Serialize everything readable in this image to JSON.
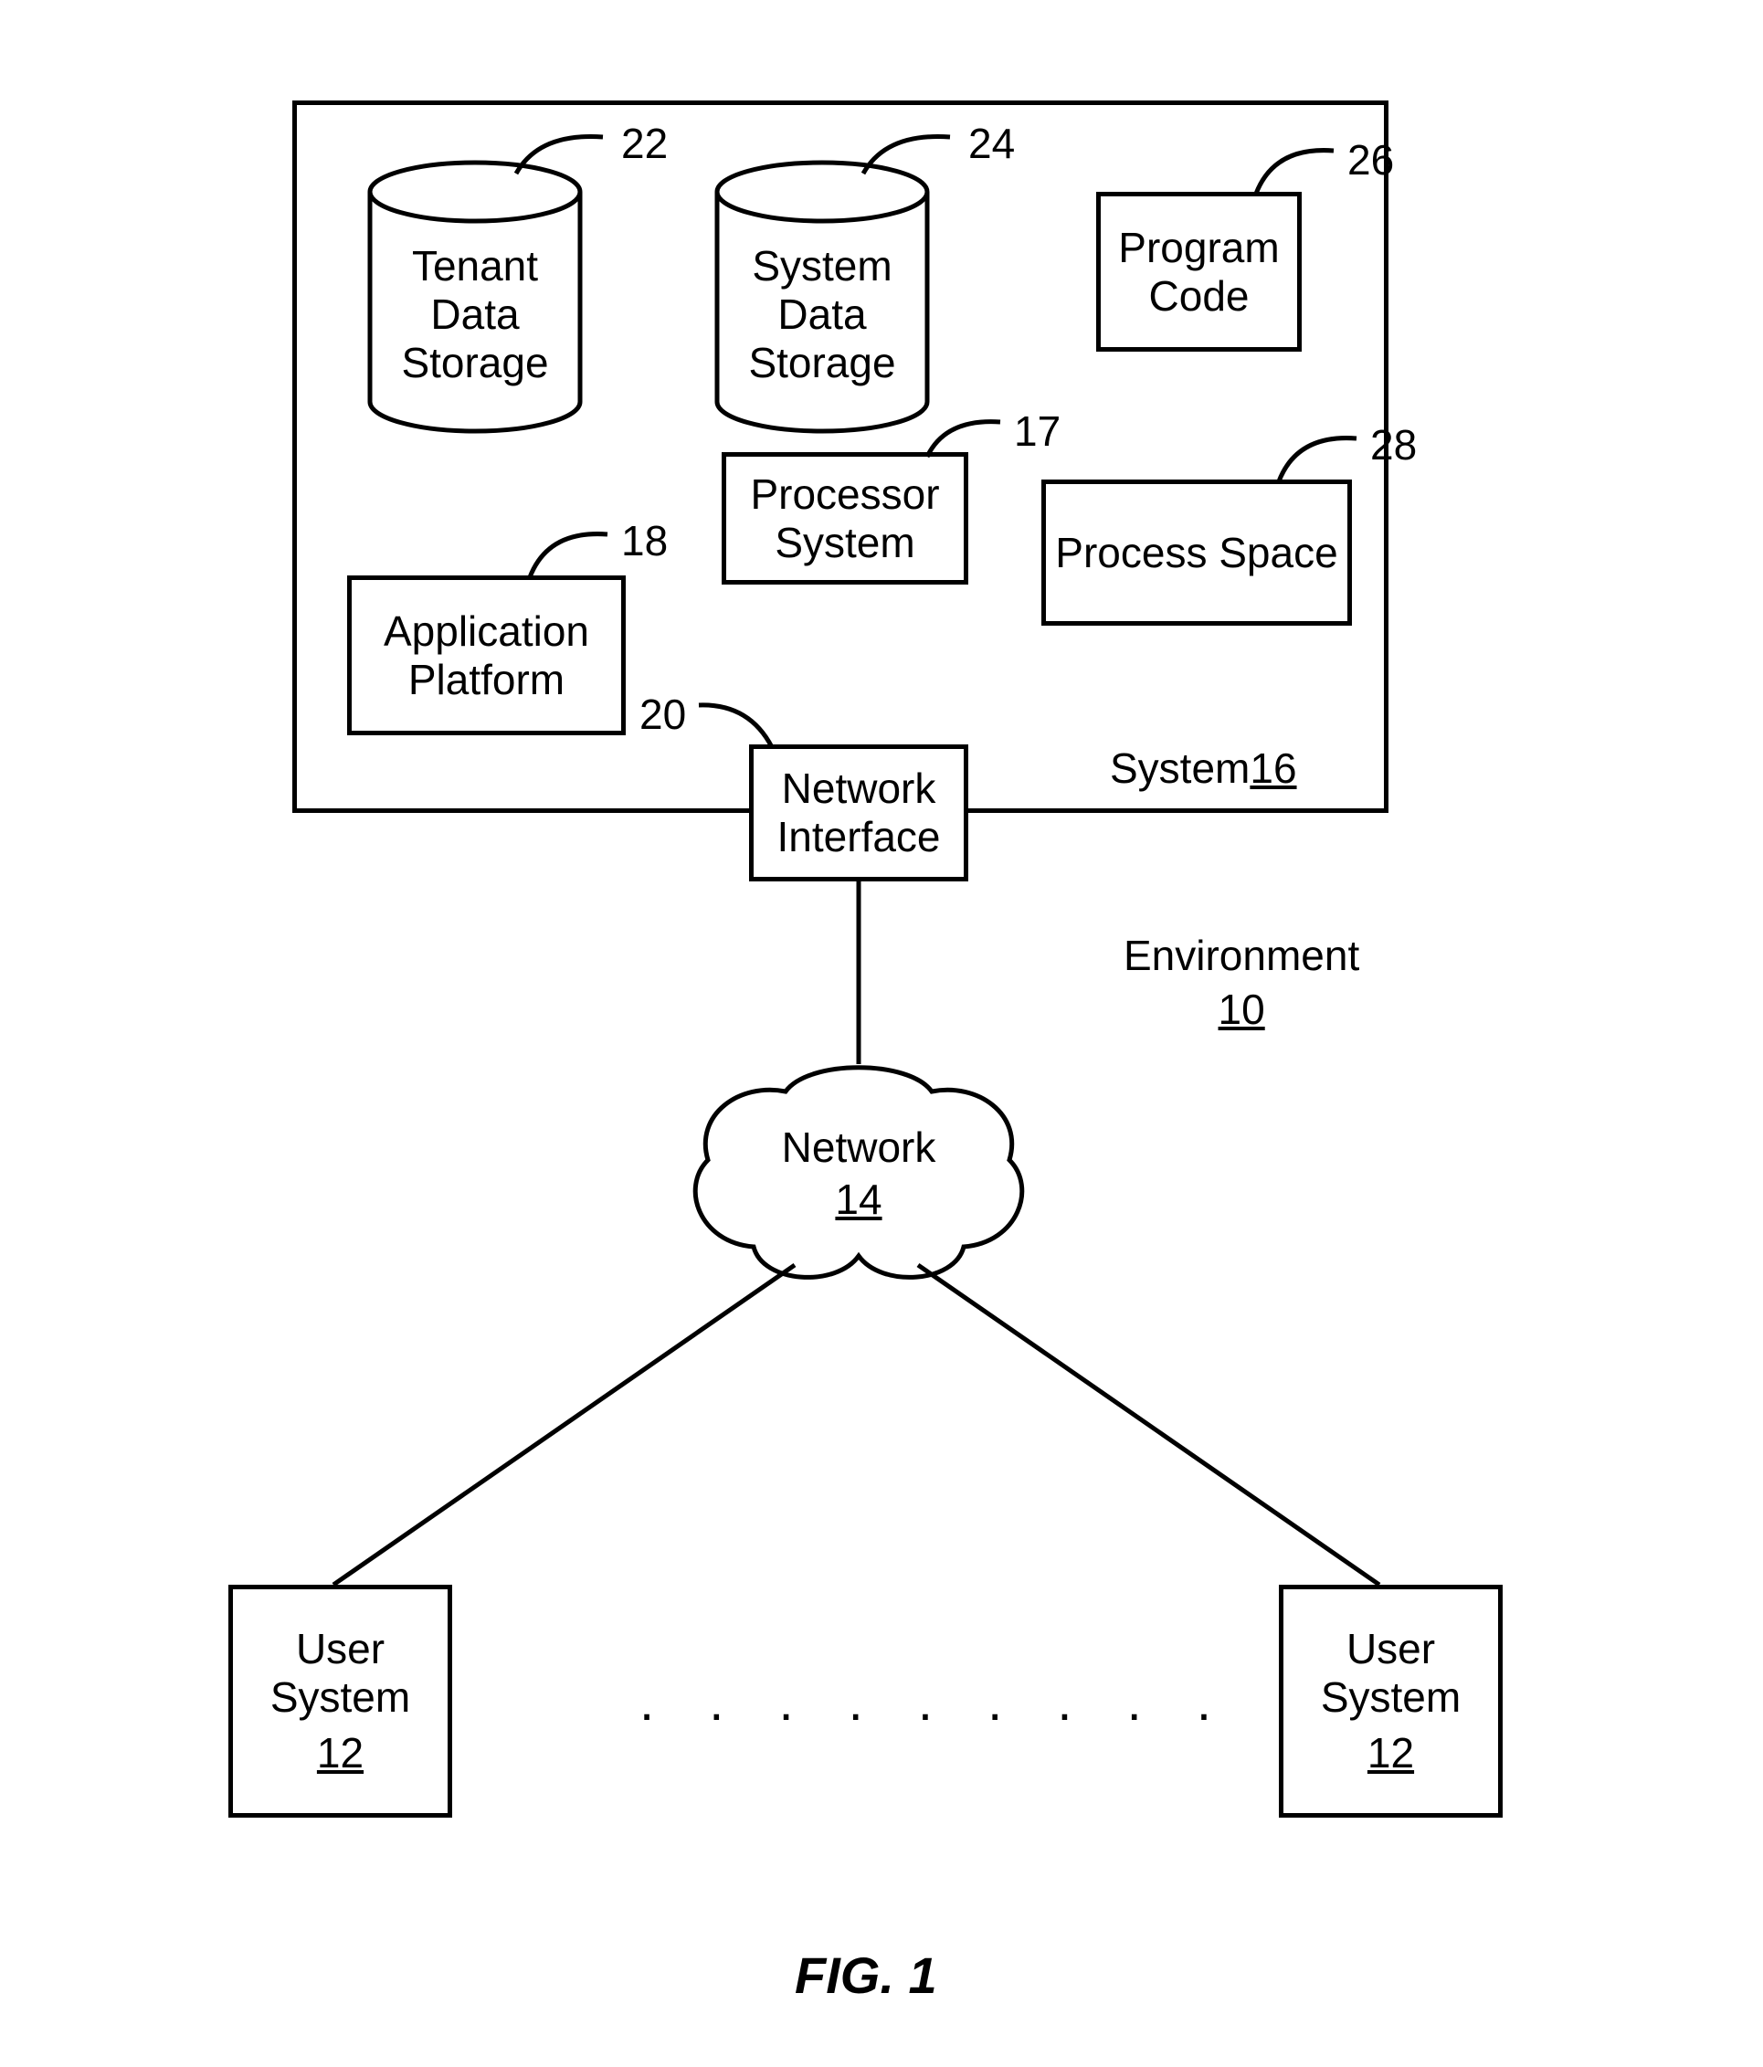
{
  "figure_caption": "FIG. 1",
  "environment": {
    "label": "Environment",
    "ref": "10"
  },
  "system16": {
    "label": "System",
    "ref": "16"
  },
  "tenant_storage": {
    "line1": "Tenant",
    "line2": "Data",
    "line3": "Storage",
    "ref": "22"
  },
  "system_storage": {
    "line1": "System",
    "line2": "Data",
    "line3": "Storage",
    "ref": "24"
  },
  "program_code": {
    "line1": "Program",
    "line2": "Code",
    "ref": "26"
  },
  "processor_system": {
    "line1": "Processor",
    "line2": "System",
    "ref": "17"
  },
  "process_space": {
    "label": "Process Space",
    "ref": "28"
  },
  "application_platform": {
    "line1": "Application",
    "line2": "Platform",
    "ref": "18"
  },
  "network_interface": {
    "line1": "Network",
    "line2": "Interface",
    "ref": "20"
  },
  "network": {
    "label": "Network",
    "ref": "14"
  },
  "user_system_left": {
    "line1": "User",
    "line2": "System",
    "ref": "12"
  },
  "user_system_right": {
    "line1": "User",
    "line2": "System",
    "ref": "12"
  },
  "ellipsis": ". . . . . . . . ."
}
